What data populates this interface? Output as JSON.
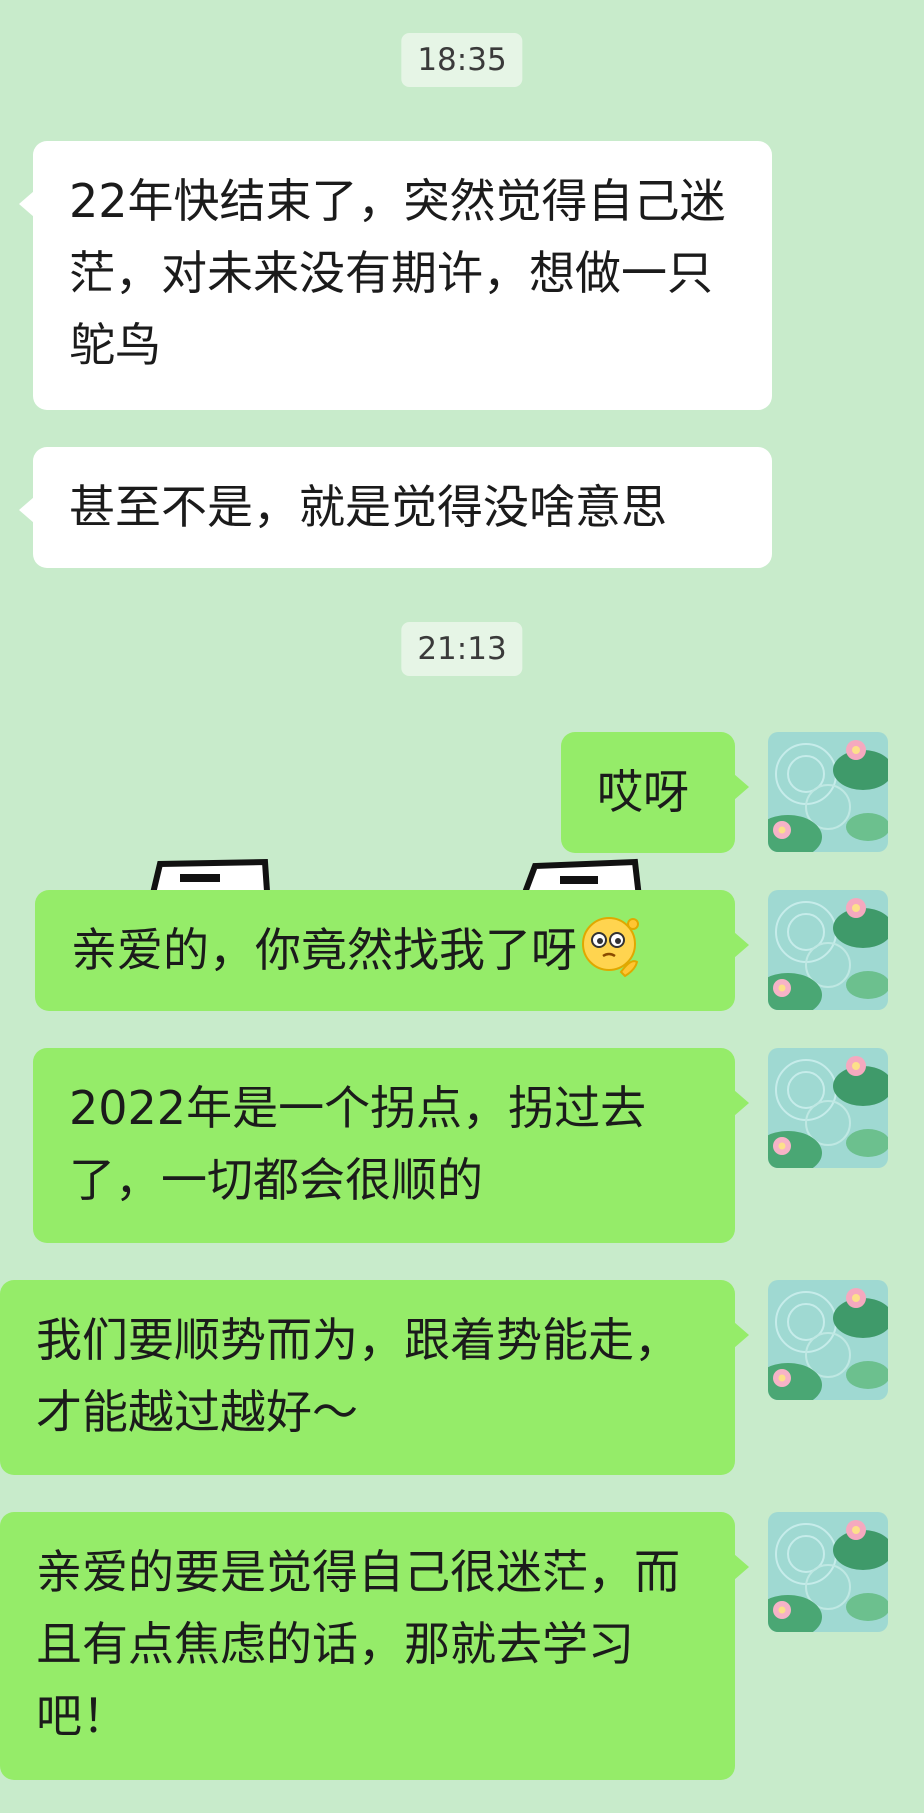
{
  "timestamps": [
    "18:35",
    "21:13"
  ],
  "messages": {
    "m1": "22年快结束了，突然觉得自己迷茫，对未来没有期许，想做一只鸵鸟",
    "m2": "甚至不是，就是觉得没啥意思",
    "m3": "哎呀",
    "m4": "亲爱的，你竟然找我了呀",
    "m5": "2022年是一个拐点，拐过去了，一切都会很顺的",
    "m6": "我们要顺势而为，跟着势能走，才能越过越好～",
    "m7": "亲爱的要是觉得自己很迷茫，而且有点焦虑的话，那就去学习吧！"
  },
  "icons": {
    "avatar": "lotus-pond-avatar-icon",
    "emoji": "thinking-face-icon"
  },
  "colors": {
    "background": "#c8ebcb",
    "incoming_bubble": "#ffffff",
    "outgoing_bubble": "#95ec69",
    "timestamp_bg": "#e6f5e6"
  }
}
